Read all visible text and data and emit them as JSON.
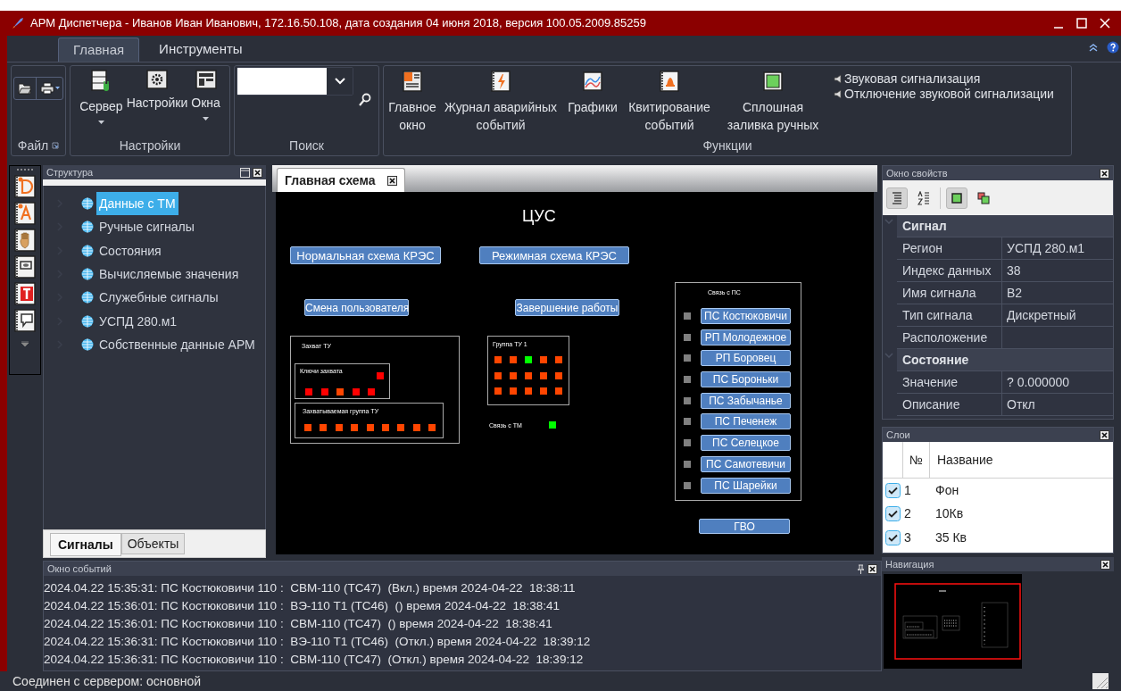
{
  "window": {
    "title": "АРМ Диспетчера - Иванов Иван Иванович, 172.16.50.108, дата создания 04 июня 2018, версия 100.05.2009.85259"
  },
  "ribbon": {
    "tabs": [
      {
        "label": "Главная",
        "selected": true
      },
      {
        "label": "Инструменты",
        "selected": false
      }
    ],
    "file_group": {
      "label": "Файл"
    },
    "settings_group": {
      "label": "Настройки",
      "buttons": [
        {
          "label": "Сервер",
          "dropdown": true
        },
        {
          "label": "Настройки",
          "dropdown": false
        },
        {
          "label": "Окна",
          "dropdown": true
        }
      ]
    },
    "search_group": {
      "label": "Поиск"
    },
    "functions_group": {
      "label": "Функции",
      "buttons": [
        {
          "label": "Главное\nокно"
        },
        {
          "label": "Журнал аварийных\nсобытий"
        },
        {
          "label": "Графики"
        },
        {
          "label": "Квитирование\nсобытий"
        },
        {
          "label": "Сплошная\nзаливка ручных"
        }
      ],
      "sound_items": [
        "Звуковая сигнализация",
        "Отключение звуковой сигнализации"
      ]
    }
  },
  "structure_panel": {
    "title": "Структура",
    "items": [
      {
        "label": "Данные с ТМ",
        "selected": true,
        "expanded": false
      },
      {
        "label": "Ручные сигналы",
        "selected": false,
        "expanded": false
      },
      {
        "label": "Состояния",
        "selected": false,
        "expanded": false
      },
      {
        "label": "Вычисляемые значения",
        "selected": false,
        "expanded": false
      },
      {
        "label": "Служебные сигналы",
        "selected": false,
        "expanded": false
      },
      {
        "label": "УСПД 280.м1",
        "selected": false,
        "expanded": false
      },
      {
        "label": "Собственные данные АРМ",
        "selected": false,
        "expanded": false
      }
    ],
    "tabs": [
      {
        "label": "Сигналы",
        "selected": true
      },
      {
        "label": "Объекты",
        "selected": false
      }
    ]
  },
  "document_tabs": [
    {
      "label": "Главная схема",
      "selected": true
    }
  ],
  "schema": {
    "title": "ЦУС",
    "buttons": [
      "Нормальная схема КРЭС",
      "Режимная схема КРЭС",
      "Смена пользователя",
      "Завершение работы"
    ],
    "capture": {
      "label": "Захват ТУ",
      "keys": {
        "label": "Ключи захвата",
        "status": {
          "color": "#ff0000"
        },
        "indicators": [
          {
            "color": "#ff0000"
          },
          {
            "color": "#ff0000"
          },
          {
            "color": "#ff4500"
          },
          {
            "color": "#ff0000"
          },
          {
            "color": "#ff0000"
          }
        ]
      },
      "group": {
        "label": "Захватываемая группа ТУ",
        "indicators": [
          {
            "color": "#ff4500"
          },
          {
            "color": "#ff4500"
          },
          {
            "color": "#ff4500"
          },
          {
            "color": "#ff4500"
          },
          {
            "color": "#ff4500"
          },
          {
            "color": "#ff4500"
          },
          {
            "color": "#ff4500"
          },
          {
            "color": "#ff4500"
          },
          {
            "color": "#ff4500"
          }
        ]
      }
    },
    "tu_group": {
      "label": "Группа ТУ 1",
      "indicators": [
        {
          "color": "#ff4500"
        },
        {
          "color": "#ff4500"
        },
        {
          "color": "#00ff00"
        },
        {
          "color": "#ff4500"
        },
        {
          "color": "#ff4500"
        },
        {
          "color": "#ff4500"
        },
        {
          "color": "#ff4500"
        },
        {
          "color": "#ff4500"
        },
        {
          "color": "#ff4500"
        },
        {
          "color": "#ff4500"
        },
        {
          "color": "#ff4500"
        },
        {
          "color": "#ff4500"
        },
        {
          "color": "#ff4500"
        },
        {
          "color": "#ff4500"
        },
        {
          "color": "#ff4500"
        }
      ]
    },
    "tm_link": {
      "label": "Связь с ТМ",
      "color": "#00ff00"
    },
    "substations": {
      "label": "Связь с ПС",
      "items": [
        {
          "label": "ПС Костюковичи",
          "color": "#808080"
        },
        {
          "label": "РП Молодежное",
          "color": "#808080"
        },
        {
          "label": "РП Боровец",
          "color": "#808080"
        },
        {
          "label": "ПС Бороньки",
          "color": "#808080"
        },
        {
          "label": "ПС Забычанье",
          "color": "#808080"
        },
        {
          "label": "ПС Печенеж",
          "color": "#808080"
        },
        {
          "label": "ПС Селецкое",
          "color": "#808080"
        },
        {
          "label": "ПС Самотевичи",
          "color": "#808080"
        },
        {
          "label": "ПС Шарейки",
          "color": "#808080"
        }
      ]
    },
    "gvo_button": "ГВО"
  },
  "properties_panel": {
    "title": "Окно свойств",
    "view_buttons": [
      {
        "selected": true
      },
      {
        "selected": false
      }
    ],
    "mode_buttons": [
      {
        "selected": true
      },
      {
        "selected": false
      }
    ],
    "sections": [
      {
        "label": "Сигнал",
        "expanded": true,
        "rows": [
          {
            "name": "Регион",
            "value": "УСПД 280.м1"
          },
          {
            "name": "Индекс данных",
            "value": "38"
          },
          {
            "name": "Имя сигнала",
            "value": "B2"
          },
          {
            "name": "Тип сигнала",
            "value": "Дискретный"
          },
          {
            "name": "Расположение",
            "value": ""
          }
        ]
      },
      {
        "label": "Состояние",
        "expanded": true,
        "rows": [
          {
            "name": "Значение",
            "value": "? 0.000000"
          },
          {
            "name": "Описание",
            "value": "Откл"
          }
        ]
      }
    ]
  },
  "layers_panel": {
    "title": "Слои",
    "columns": [
      "№",
      "Название"
    ],
    "rows": [
      {
        "number": "1",
        "name": "Фон",
        "checked": true
      },
      {
        "number": "2",
        "name": "10Кв",
        "checked": true
      },
      {
        "number": "3",
        "name": "35 Кв",
        "checked": true
      }
    ]
  },
  "navigation_panel": {
    "title": "Навигация"
  },
  "events_panel": {
    "title": "Окно событий",
    "lines": [
      "2024.04.22 15:35:31: ПС Костюковичи 110 :  СВМ-110 (ТС47)  (Вкл.) время 2024-04-22  18:38:11",
      "2024.04.22 15:36:01: ПС Костюковичи 110 :  ВЭ-110 Т1 (ТС46)  () время 2024-04-22  18:38:41",
      "2024.04.22 15:36:01: ПС Костюковичи 110 :  СВМ-110 (ТС47)  () время 2024-04-22  18:38:41",
      "2024.04.22 15:36:31: ПС Костюковичи 110 :  ВЭ-110 Т1 (ТС46)  (Откл.) время 2024-04-22  18:39:12",
      "2024.04.22 15:36:31: ПС Костюковичи 110 :  СВМ-110 (ТС47)  (Откл.) время 2024-04-22  18:39:12"
    ]
  },
  "status_bar": "Соединен с сервером: основной"
}
